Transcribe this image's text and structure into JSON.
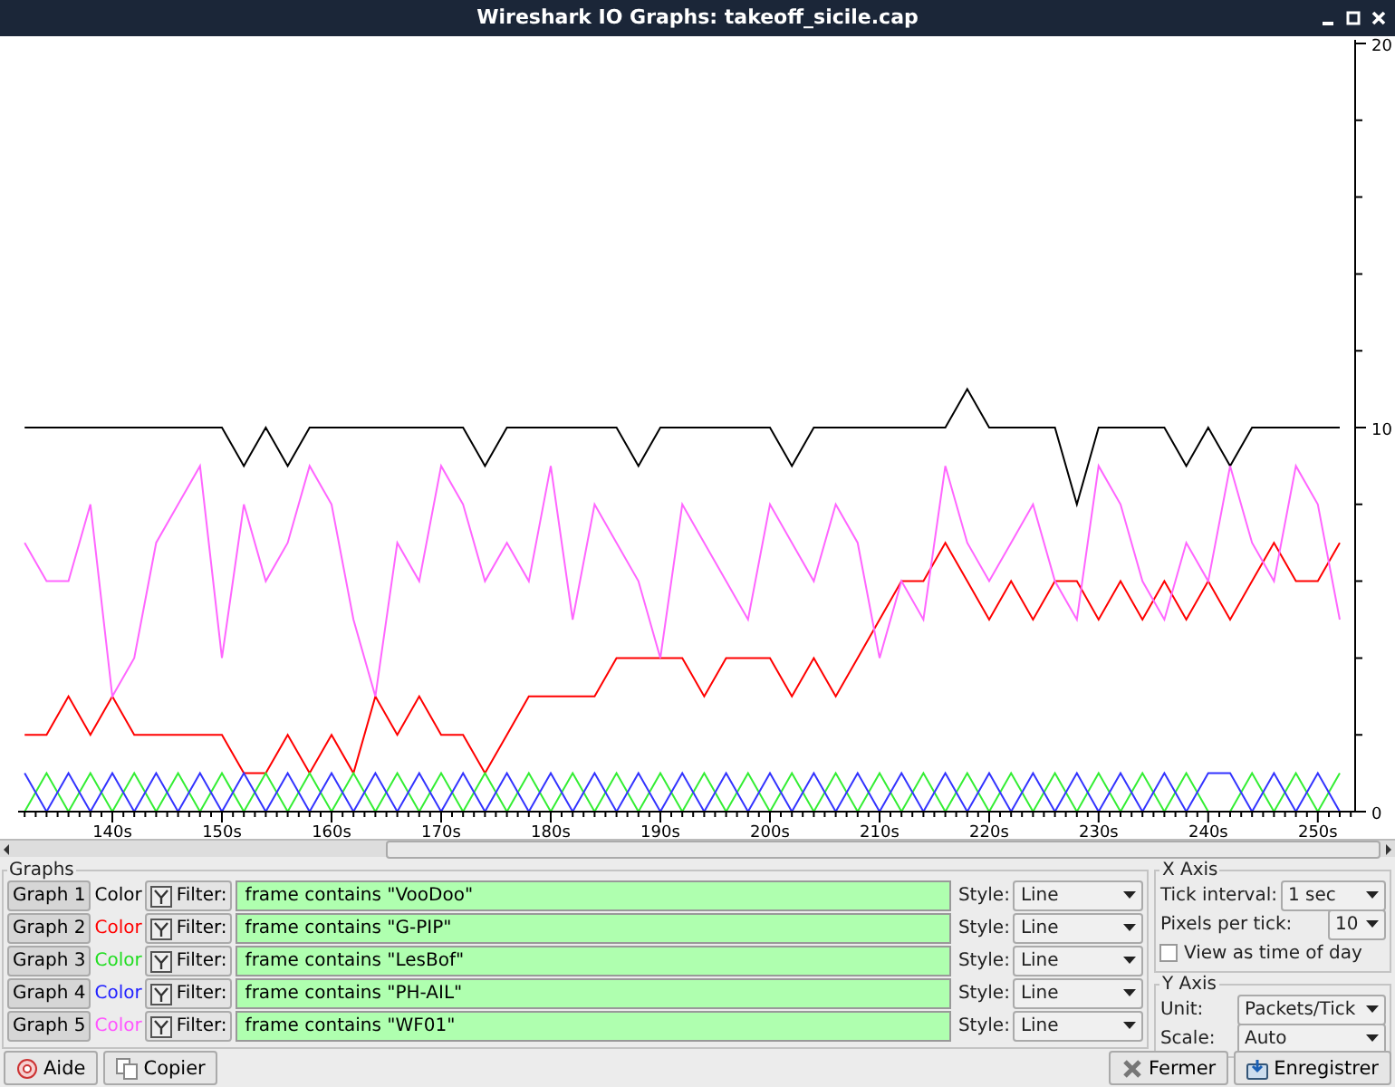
{
  "window": {
    "title": "Wireshark IO Graphs: takeoff_sicile.cap"
  },
  "chart": {
    "chart_data": {
      "type": "line",
      "xlim": [
        131.4,
        253.4
      ],
      "ylim": [
        0,
        20
      ],
      "yticks": [
        0,
        10,
        20
      ],
      "xticks": [
        {
          "value": 140,
          "label": "140s"
        },
        {
          "value": 150,
          "label": "150s"
        },
        {
          "value": 160,
          "label": "160s"
        },
        {
          "value": 170,
          "label": "170s"
        },
        {
          "value": 180,
          "label": "180s"
        },
        {
          "value": 190,
          "label": "190s"
        },
        {
          "value": 200,
          "label": "200s"
        },
        {
          "value": 210,
          "label": "210s"
        },
        {
          "value": 220,
          "label": "220s"
        },
        {
          "value": 230,
          "label": "230s"
        },
        {
          "value": 240,
          "label": "240s"
        },
        {
          "value": 250,
          "label": "250s"
        }
      ],
      "x": [
        132,
        134,
        136,
        138,
        140,
        142,
        144,
        146,
        148,
        150,
        152,
        154,
        156,
        158,
        160,
        162,
        164,
        166,
        168,
        170,
        172,
        174,
        176,
        178,
        180,
        182,
        184,
        186,
        188,
        190,
        192,
        194,
        196,
        198,
        200,
        202,
        204,
        206,
        208,
        210,
        212,
        214,
        216,
        218,
        220,
        222,
        224,
        226,
        228,
        230,
        232,
        234,
        236,
        238,
        240,
        242,
        244,
        246,
        248,
        250,
        252
      ],
      "series": [
        {
          "color": "#000000",
          "values": [
            10,
            10,
            10,
            10,
            10,
            10,
            10,
            10,
            10,
            10,
            9,
            10,
            9,
            10,
            10,
            10,
            10,
            10,
            10,
            10,
            10,
            9,
            10,
            10,
            10,
            10,
            10,
            10,
            9,
            10,
            10,
            10,
            10,
            10,
            10,
            9,
            10,
            10,
            10,
            10,
            10,
            10,
            10,
            11,
            10,
            10,
            10,
            10,
            8,
            10,
            10,
            10,
            10,
            9,
            10,
            9,
            10,
            10,
            10,
            10,
            10
          ]
        },
        {
          "color": "#ff0000",
          "values": [
            2,
            2,
            3,
            2,
            3,
            2,
            2,
            2,
            2,
            2,
            1,
            1,
            2,
            1,
            2,
            1,
            3,
            2,
            3,
            2,
            2,
            1,
            2,
            3,
            3,
            3,
            3,
            4,
            4,
            4,
            4,
            3,
            4,
            4,
            4,
            3,
            4,
            3,
            4,
            5,
            6,
            6,
            7,
            6,
            5,
            6,
            5,
            6,
            6,
            5,
            6,
            5,
            6,
            5,
            6,
            5,
            6,
            7,
            6,
            6,
            7
          ]
        },
        {
          "color": "#33ee33",
          "values": [
            0,
            1,
            0,
            1,
            0,
            1,
            0,
            1,
            0,
            1,
            0,
            1,
            0,
            1,
            0,
            1,
            0,
            1,
            0,
            1,
            0,
            1,
            0,
            1,
            0,
            1,
            0,
            1,
            0,
            1,
            0,
            1,
            0,
            1,
            0,
            1,
            0,
            1,
            0,
            1,
            0,
            1,
            0,
            1,
            0,
            1,
            0,
            1,
            0,
            1,
            0,
            1,
            0,
            1,
            0,
            0,
            1,
            0,
            1,
            0,
            1
          ]
        },
        {
          "color": "#3333ff",
          "values": [
            1,
            0,
            1,
            0,
            1,
            0,
            1,
            0,
            1,
            0,
            1,
            0,
            1,
            0,
            1,
            0,
            1,
            0,
            1,
            0,
            1,
            0,
            1,
            0,
            1,
            0,
            1,
            0,
            1,
            0,
            1,
            0,
            1,
            0,
            1,
            0,
            1,
            0,
            1,
            0,
            1,
            0,
            1,
            0,
            1,
            0,
            1,
            0,
            1,
            0,
            1,
            0,
            1,
            0,
            1,
            1,
            0,
            1,
            0,
            1,
            0
          ]
        },
        {
          "color": "#ff66ff",
          "values": [
            7,
            6,
            6,
            8,
            3,
            4,
            7,
            8,
            9,
            4,
            8,
            6,
            7,
            9,
            8,
            5,
            3,
            7,
            6,
            9,
            8,
            6,
            7,
            6,
            9,
            5,
            8,
            7,
            6,
            4,
            8,
            7,
            6,
            5,
            8,
            7,
            6,
            8,
            7,
            4,
            6,
            5,
            9,
            7,
            6,
            7,
            8,
            6,
            5,
            9,
            8,
            6,
            5,
            7,
            6,
            9,
            7,
            6,
            9,
            8,
            5
          ]
        }
      ]
    }
  },
  "graphs": {
    "title": "Graphs",
    "rows": [
      {
        "button": "Graph 1",
        "color_label": "Color",
        "color": "#000000",
        "filter_label": "Filter:",
        "filter": "frame contains \"VooDoo\"",
        "style_label": "Style:",
        "style": "Line"
      },
      {
        "button": "Graph 2",
        "color_label": "Color",
        "color": "#ff0000",
        "filter_label": "Filter:",
        "filter": "frame contains \"G-PIP\"",
        "style_label": "Style:",
        "style": "Line"
      },
      {
        "button": "Graph 3",
        "color_label": "Color",
        "color": "#22dd22",
        "filter_label": "Filter:",
        "filter": "frame contains \"LesBof\"",
        "style_label": "Style:",
        "style": "Line"
      },
      {
        "button": "Graph 4",
        "color_label": "Color",
        "color": "#2222ff",
        "filter_label": "Filter:",
        "filter": "frame contains \"PH-AIL\"",
        "style_label": "Style:",
        "style": "Line"
      },
      {
        "button": "Graph 5",
        "color_label": "Color",
        "color": "#ff55ff",
        "filter_label": "Filter:",
        "filter": "frame contains \"WF01\"",
        "style_label": "Style:",
        "style": "Line"
      }
    ]
  },
  "x_axis": {
    "title": "X Axis",
    "tick_interval_label": "Tick interval:",
    "tick_interval": "1 sec",
    "pixels_label": "Pixels per tick:",
    "pixels": "10",
    "time_of_day": {
      "label": "View as time of day",
      "checked": false
    }
  },
  "y_axis": {
    "title": "Y Axis",
    "unit_label": "Unit:",
    "unit": "Packets/Tick",
    "scale_label": "Scale:",
    "scale": "Auto"
  },
  "buttons": [
    {
      "label": "Aide",
      "kind": "help"
    },
    {
      "label": "Copier",
      "kind": "copy"
    },
    {
      "label": "Fermer",
      "kind": "close"
    },
    {
      "label": "Enregistrer",
      "kind": "save"
    }
  ]
}
